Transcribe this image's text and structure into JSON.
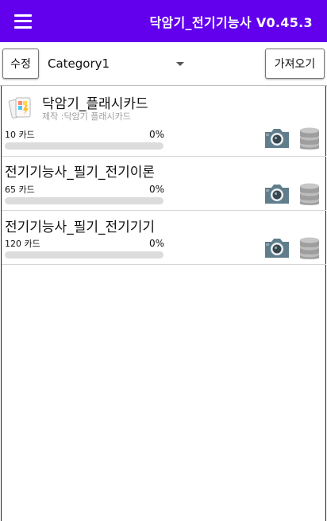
{
  "appbar": {
    "title": "닥암기_전기기능사 V0.45.3",
    "menu_icon": "hamburger-menu-icon",
    "color": "#6200ee"
  },
  "toolbar": {
    "edit_label": "수정",
    "category": "Category1",
    "import_label": "가져오기"
  },
  "decks": [
    {
      "title": "닥암기_플래시카드",
      "subtitle": "제작 :닥암기 플래시카드",
      "count": "10 카드",
      "percent_label": "0%",
      "progress": 0,
      "has_icon": true
    },
    {
      "title": "전기기능사_필기_전기이론",
      "count": "65 카드",
      "percent_label": "0%",
      "progress": 0
    },
    {
      "title": "전기기능사_필기_전기기기",
      "count": "120 카드",
      "percent_label": "0%",
      "progress": 0
    }
  ],
  "icons": {
    "deck": "flashcard-deck-icon",
    "camera": "camera-icon",
    "database": "database-icon"
  }
}
